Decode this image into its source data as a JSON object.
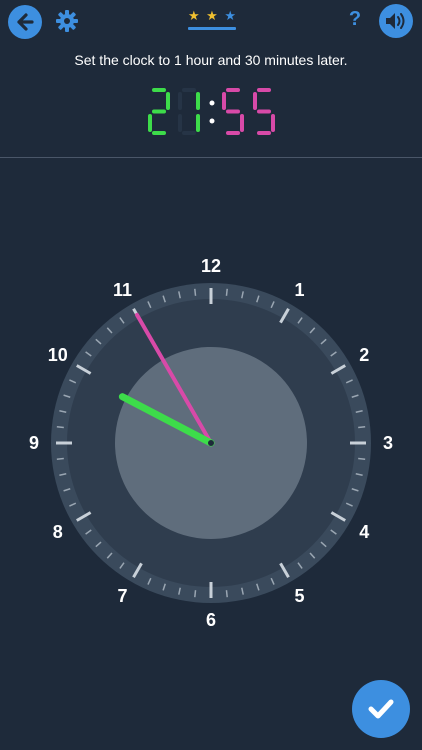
{
  "header": {
    "back_icon": "arrow-left-icon",
    "settings_icon": "gear-icon",
    "stars": [
      "filled",
      "filled",
      "empty"
    ],
    "help_label": "?",
    "sound_icon": "speaker-icon"
  },
  "task": {
    "instruction": "Set the clock to 1 hour and 30 minutes later."
  },
  "digital_clock": {
    "hours": "21",
    "separator": ":",
    "minutes": "55",
    "hours_color": "#3ddc4a",
    "minutes_color": "#d84aa8"
  },
  "analog_clock": {
    "numbers": [
      "12",
      "1",
      "2",
      "3",
      "4",
      "5",
      "6",
      "7",
      "8",
      "9",
      "10",
      "11"
    ],
    "hour_hand_color": "#3ddc4a",
    "minute_hand_color": "#d84aa8",
    "hour_value": 9.92,
    "minute_value": 55
  },
  "colors": {
    "background": "#1e2a3a",
    "accent": "#3d8fe0",
    "star_filled": "#f0c030",
    "star_empty": "#3d8fe0"
  },
  "footer": {
    "confirm_icon": "checkmark-icon"
  }
}
